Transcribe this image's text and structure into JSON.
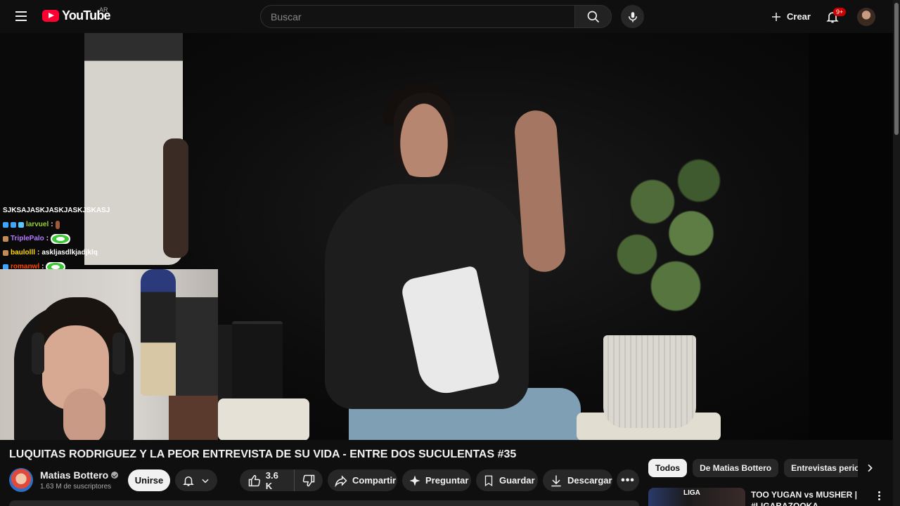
{
  "header": {
    "logo_text": "YouTube",
    "region": "AR",
    "search_placeholder": "Buscar",
    "create_label": "Crear",
    "notifications_badge": "9+"
  },
  "chat": [
    {
      "user": "SJKSAJASKJASKJASKJSKASJ",
      "user_color": "#ffffff",
      "separator": "",
      "message": "",
      "badges": [],
      "emote": ""
    },
    {
      "user": "larvuel",
      "user_color": "#9acd32",
      "separator": ":",
      "message": "",
      "badges": [
        "#3ea6ff",
        "#3ea6ff",
        "#5ac8fa"
      ],
      "emote": "small"
    },
    {
      "user": "TriplePalo",
      "user_color": "#b57bff",
      "separator": ":",
      "message": "",
      "badges": [
        "#c08a5a"
      ],
      "emote": "wide"
    },
    {
      "user": "baulolll",
      "user_color": "#ffd700",
      "separator": ":",
      "message": "askljasdlkjadjklq",
      "badges": [
        "#c08a5a"
      ],
      "emote": ""
    },
    {
      "user": "romanwl",
      "user_color": "#ff4500",
      "separator": ":",
      "message": "",
      "badges": [
        "#3ea6ff"
      ],
      "emote": "wide"
    }
  ],
  "video": {
    "title": "LUQUITAS RODRIGUEZ Y LA PEOR ENTREVISTA DE SU VIDA - ENTRE DOS SUCULENTAS #35"
  },
  "channel": {
    "name": "Matias Bottero",
    "subscribers": "1.63 M de suscriptores",
    "join_label": "Unirse"
  },
  "actions": {
    "likes": "3.6 K",
    "share": "Compartir",
    "ask": "Preguntar",
    "save": "Guardar",
    "download": "Descargar",
    "more": "•••"
  },
  "chips": [
    "Todos",
    "De Matias Bottero",
    "Entrevistas periodís"
  ],
  "recommendation": {
    "thumb_text": "LIGA",
    "title": "TOO YUGAN vs MUSHER | #LIGABAZOOKA NACIONAL"
  }
}
